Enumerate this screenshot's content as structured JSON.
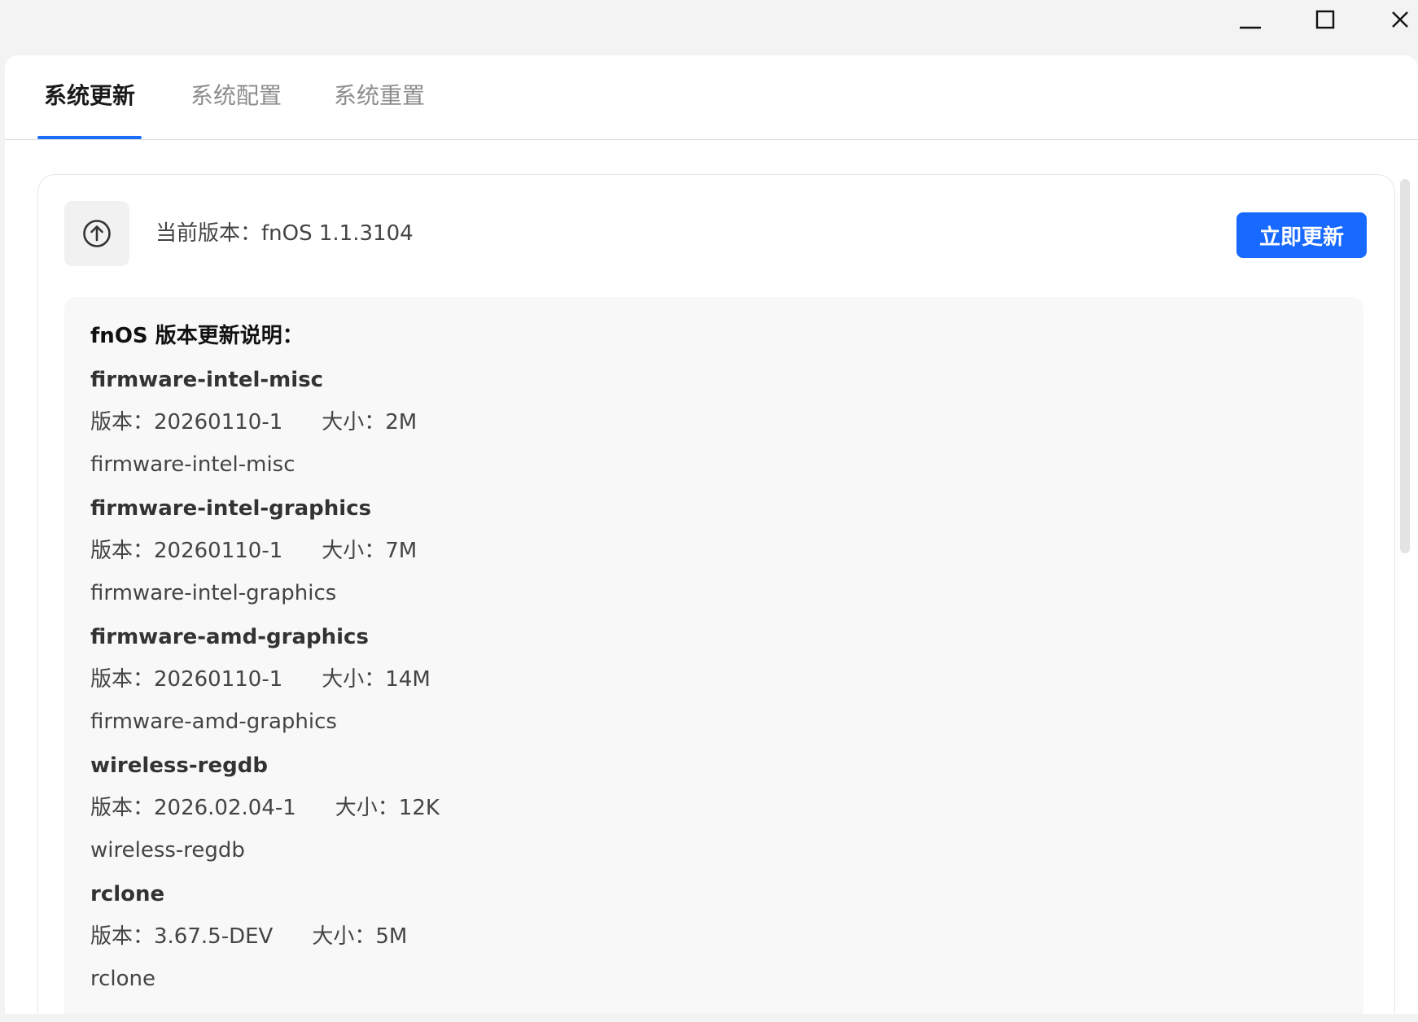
{
  "window": {
    "minimize_icon": "minimize-icon",
    "maximize_icon": "maximize-icon",
    "close_icon": "close-icon"
  },
  "tabs": [
    {
      "label": "系统更新",
      "active": true
    },
    {
      "label": "系统配置",
      "active": false
    },
    {
      "label": "系统重置",
      "active": false
    }
  ],
  "header": {
    "icon": "arrow-up-circle-icon",
    "current_version": "当前版本：fnOS 1.1.3104",
    "update_button": "立即更新"
  },
  "notes": {
    "title": "fnOS 版本更新说明：",
    "packages": [
      {
        "name": "firmware-intel-misc",
        "version": "版本：20260110-1",
        "size": "大小：2M",
        "description": "firmware-intel-misc"
      },
      {
        "name": "firmware-intel-graphics",
        "version": "版本：20260110-1",
        "size": "大小：7M",
        "description": "firmware-intel-graphics"
      },
      {
        "name": "firmware-amd-graphics",
        "version": "版本：20260110-1",
        "size": "大小：14M",
        "description": "firmware-amd-graphics"
      },
      {
        "name": "wireless-regdb",
        "version": "版本：2026.02.04-1",
        "size": "大小：12K",
        "description": "wireless-regdb"
      },
      {
        "name": "rclone",
        "version": "版本：3.67.5-DEV",
        "size": "大小：5M",
        "description": "rclone"
      }
    ]
  },
  "colors": {
    "accent": "#1769ff",
    "tab_active": "#1a1a1a",
    "tab_inactive": "#8c8c8c"
  }
}
